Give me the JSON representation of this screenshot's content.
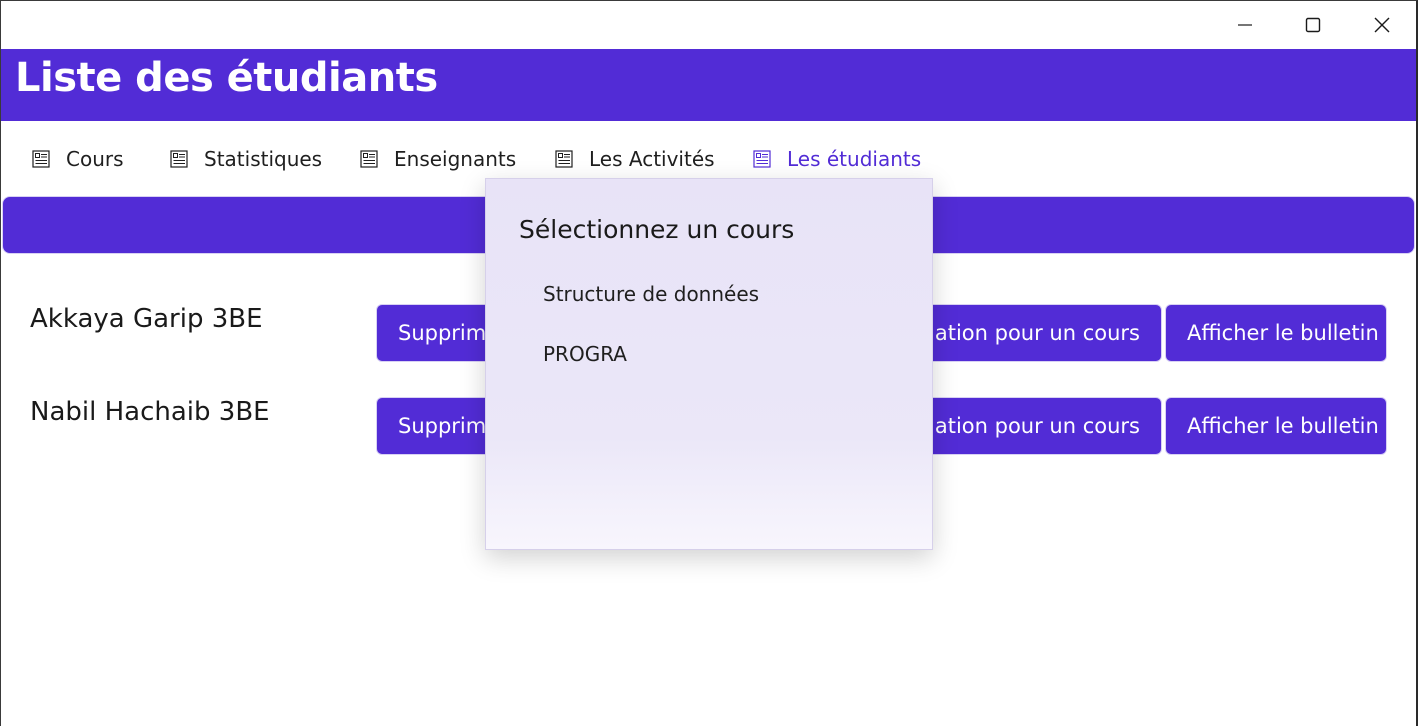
{
  "window": {
    "controls": [
      "minimize-icon",
      "maximize-icon",
      "close-icon"
    ]
  },
  "header": {
    "title": "Liste des étudiants",
    "color": "#522cd6"
  },
  "nav": {
    "items": [
      {
        "label": "Cours",
        "icon": "list-icon"
      },
      {
        "label": "Statistiques",
        "icon": "list-icon"
      },
      {
        "label": "Enseignants",
        "icon": "list-icon"
      },
      {
        "label": "Les Activités",
        "icon": "list-icon"
      },
      {
        "label": "Les étudiants",
        "icon": "list-icon",
        "active": true
      }
    ]
  },
  "students": [
    {
      "name": "Akkaya Garip 3BE",
      "delete_label": "Supprimer",
      "eval_label": "Ajouter une évaluation pour un cours",
      "bulletin_label": "Afficher le bulletin"
    },
    {
      "name": "Nabil Hachaib 3BE",
      "delete_label": "Supprimer",
      "eval_label": "Ajouter une évaluation pour un cours",
      "bulletin_label": "Afficher le bulletin"
    }
  ],
  "flyout": {
    "title": "Sélectionnez un cours",
    "options": [
      "Structure de données",
      "PROGRA"
    ]
  }
}
